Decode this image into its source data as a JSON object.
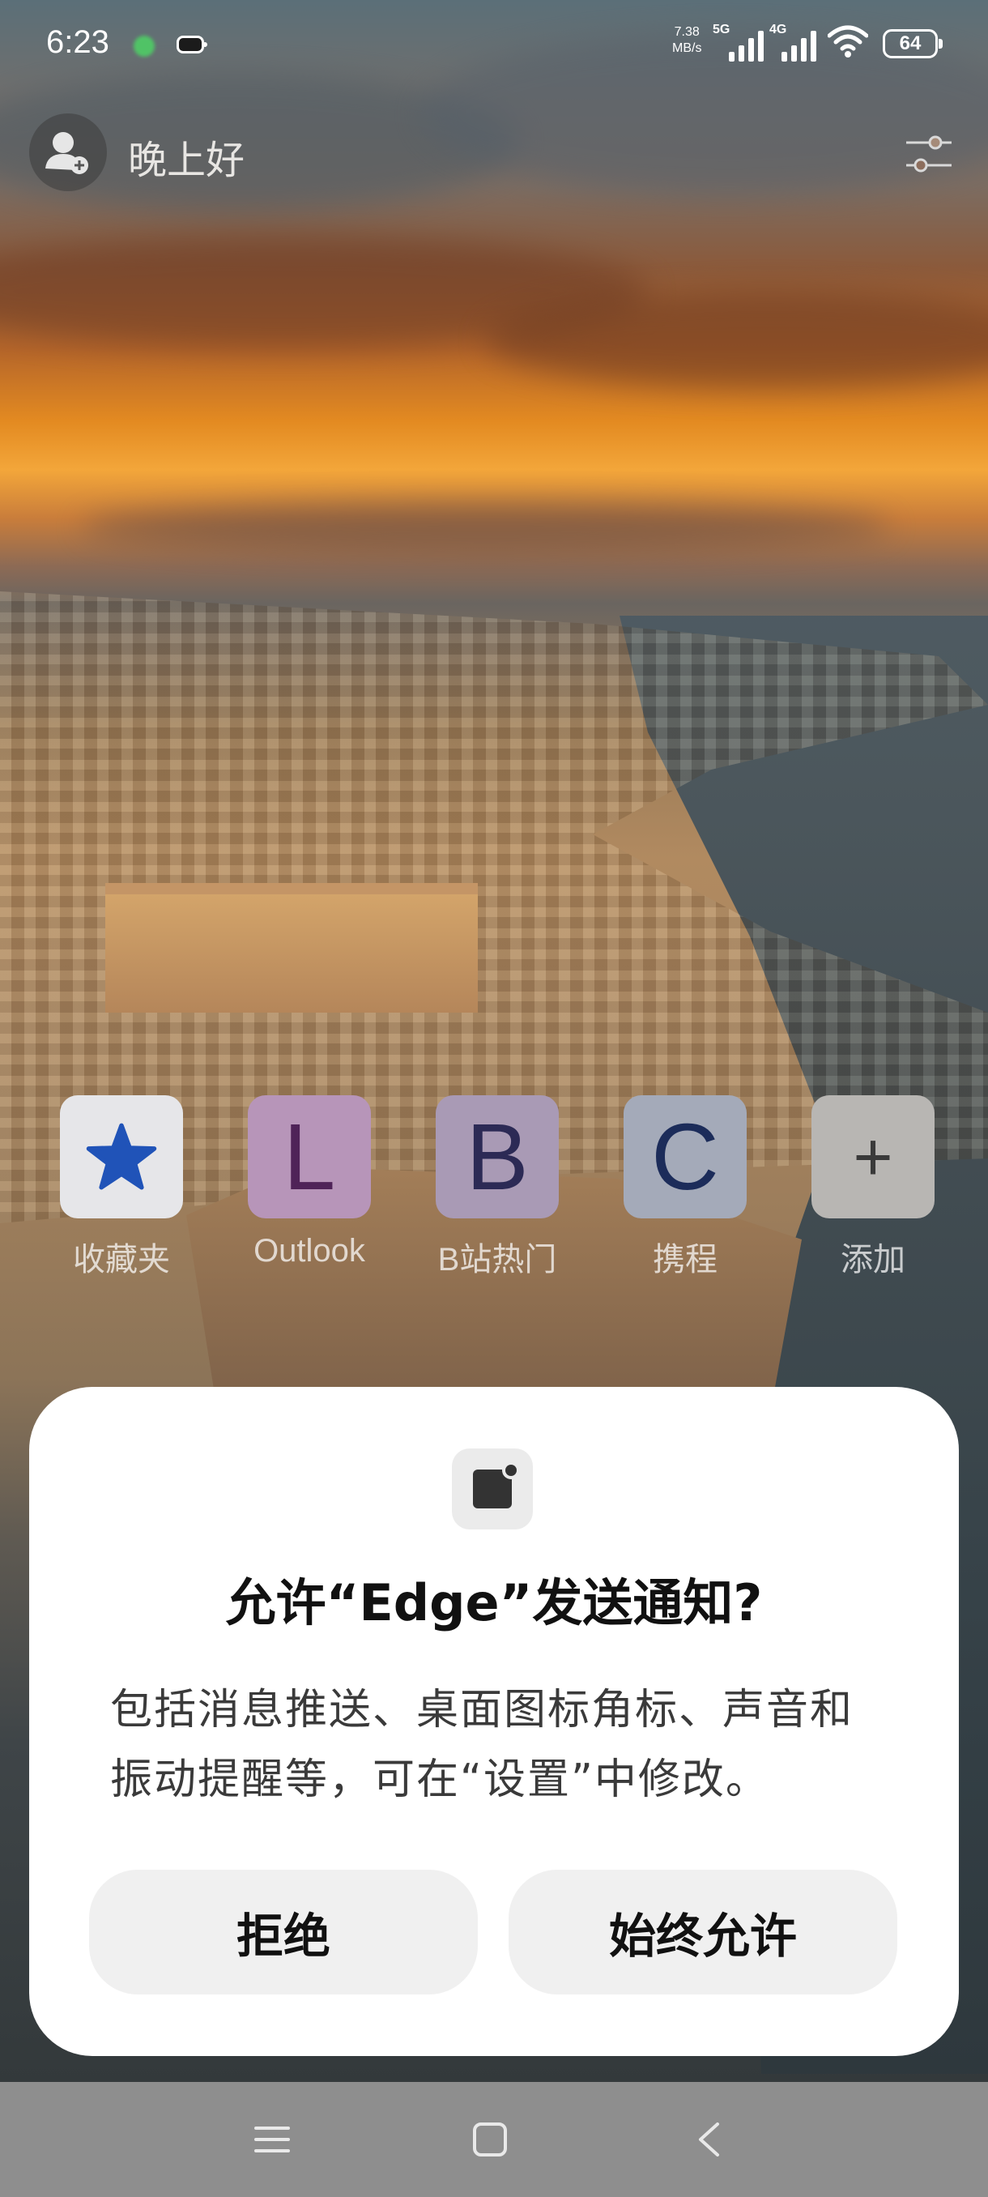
{
  "status_bar": {
    "time": "6:23",
    "speed_value": "7.38",
    "speed_unit": "MB/s",
    "network_5g": "5G",
    "network_4g": "4G",
    "battery": "64"
  },
  "header": {
    "greeting": "晚上好"
  },
  "quick_links": [
    {
      "label": "收藏夹",
      "glyph": "",
      "icon": "star-icon",
      "tile_color": "#e6e6e9",
      "glyph_color": "#2053b8"
    },
    {
      "label": "Outlook",
      "glyph": "L",
      "icon": "letter-l-icon",
      "tile_color": "#b795b9",
      "glyph_color": "#4f2358"
    },
    {
      "label": "B站热门",
      "glyph": "B",
      "icon": "letter-b-icon",
      "tile_color": "#a99ab5",
      "glyph_color": "#2c2a55"
    },
    {
      "label": "携程",
      "glyph": "C",
      "icon": "letter-c-icon",
      "tile_color": "#a4aab9",
      "glyph_color": "#1c2c5a"
    },
    {
      "label": "添加",
      "glyph": "+",
      "icon": "plus-icon",
      "tile_color": "#b8b6b3",
      "glyph_color": "#3a3a3a"
    }
  ],
  "dialog": {
    "title": "允许“Edge”发送通知?",
    "body": "包括消息推送、桌面图标角标、声音和振动提醒等，可在“设置”中修改。",
    "deny_label": "拒绝",
    "allow_label": "始终允许"
  },
  "colors": {
    "dialog_bg": "#ffffff",
    "button_bg": "#f0f0f0",
    "nav_bar": "#8e8e8e"
  }
}
